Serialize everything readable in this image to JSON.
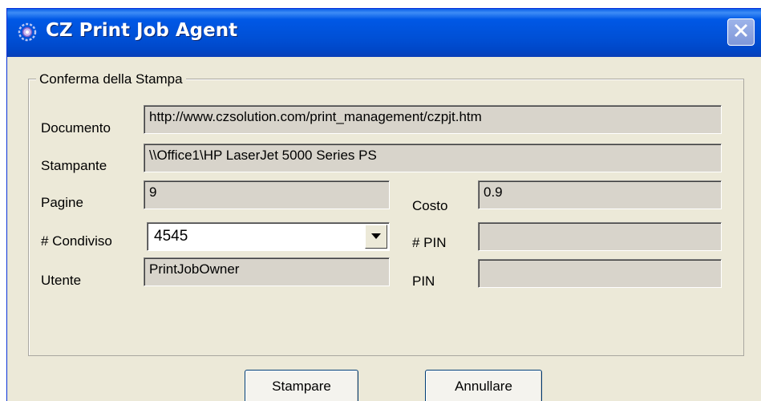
{
  "window": {
    "title": "CZ Print Job Agent",
    "title_icon": "globe-gear-icon",
    "close_icon": "close-icon"
  },
  "group": {
    "legend": "Conferma della Stampa"
  },
  "fields": {
    "documento": {
      "label": "Documento",
      "value": "http://www.czsolution.com/print_management/czpjt.htm"
    },
    "stampante": {
      "label": "Stampante",
      "value": "\\\\Office1\\HP LaserJet 5000 Series PS"
    },
    "pagine": {
      "label": "Pagine",
      "value": "9"
    },
    "costo": {
      "label": "Costo",
      "value": "0.9"
    },
    "condiviso": {
      "label": "# Condiviso",
      "value": "4545"
    },
    "pin_hash": {
      "label": "# PIN",
      "value": ""
    },
    "utente": {
      "label": "Utente",
      "value": "PrintJobOwner"
    },
    "pin": {
      "label": "PIN",
      "value": ""
    }
  },
  "buttons": {
    "print": "Stampare",
    "cancel": "Annullare"
  },
  "colors": {
    "titlebar": "#0050d6",
    "window_bg": "#ece9d8",
    "readonly_field": "#d8d4cb"
  }
}
